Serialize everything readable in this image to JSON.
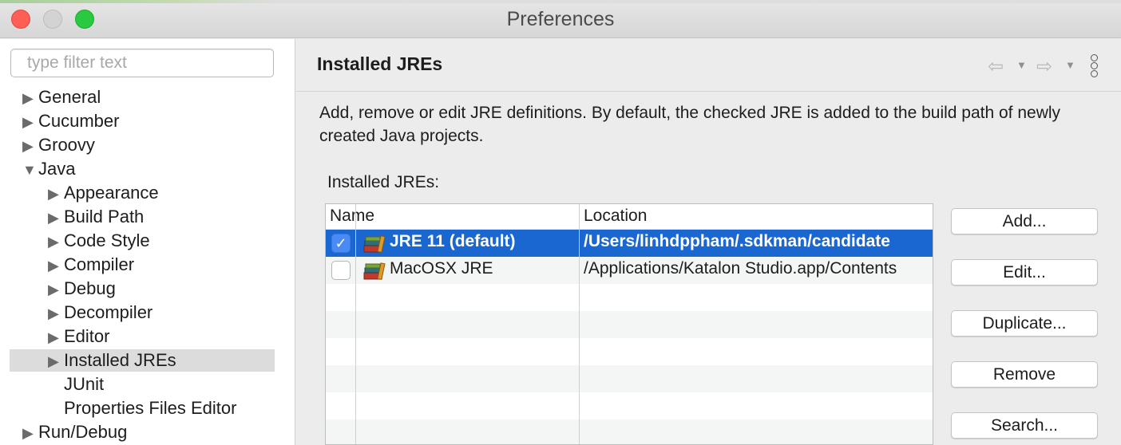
{
  "window": {
    "title": "Preferences"
  },
  "sidebar": {
    "filter_placeholder": "type filter text",
    "items": [
      {
        "label": "General",
        "expanded": false
      },
      {
        "label": "Cucumber",
        "expanded": false
      },
      {
        "label": "Groovy",
        "expanded": false
      },
      {
        "label": "Java",
        "expanded": true
      },
      {
        "label": "Appearance",
        "expanded": false
      },
      {
        "label": "Build Path",
        "expanded": false
      },
      {
        "label": "Code Style",
        "expanded": false
      },
      {
        "label": "Compiler",
        "expanded": false
      },
      {
        "label": "Debug",
        "expanded": false
      },
      {
        "label": "Decompiler",
        "expanded": false
      },
      {
        "label": "Editor",
        "expanded": false
      },
      {
        "label": "Installed JREs",
        "expanded": false,
        "selected": true
      },
      {
        "label": "JUnit"
      },
      {
        "label": "Properties Files Editor"
      },
      {
        "label": "Run/Debug",
        "expanded": false
      }
    ]
  },
  "main": {
    "title": "Installed JREs",
    "description": "Add, remove or edit JRE definitions. By default, the checked JRE is added to the build path of newly created Java projects.",
    "list_label": "Installed JREs:",
    "columns": [
      "Name",
      "Location"
    ],
    "rows": [
      {
        "name": "JRE 11 (default)",
        "location": "/Users/linhdppham/.sdkman/candidate",
        "checked": true,
        "selected": true
      },
      {
        "name": "MacOSX JRE",
        "location": "/Applications/Katalon Studio.app/Contents",
        "checked": false,
        "selected": false
      }
    ],
    "buttons": {
      "add": "Add...",
      "edit": "Edit...",
      "duplicate": "Duplicate...",
      "remove": "Remove",
      "search": "Search..."
    }
  },
  "icons": {
    "back": "back-arrow-icon",
    "forward": "forward-arrow-icon",
    "menu": "more-vertical-icon",
    "jre": "library-books-icon"
  },
  "colors": {
    "selection": "#1a67d1",
    "checkbox": "#4a8af4"
  }
}
